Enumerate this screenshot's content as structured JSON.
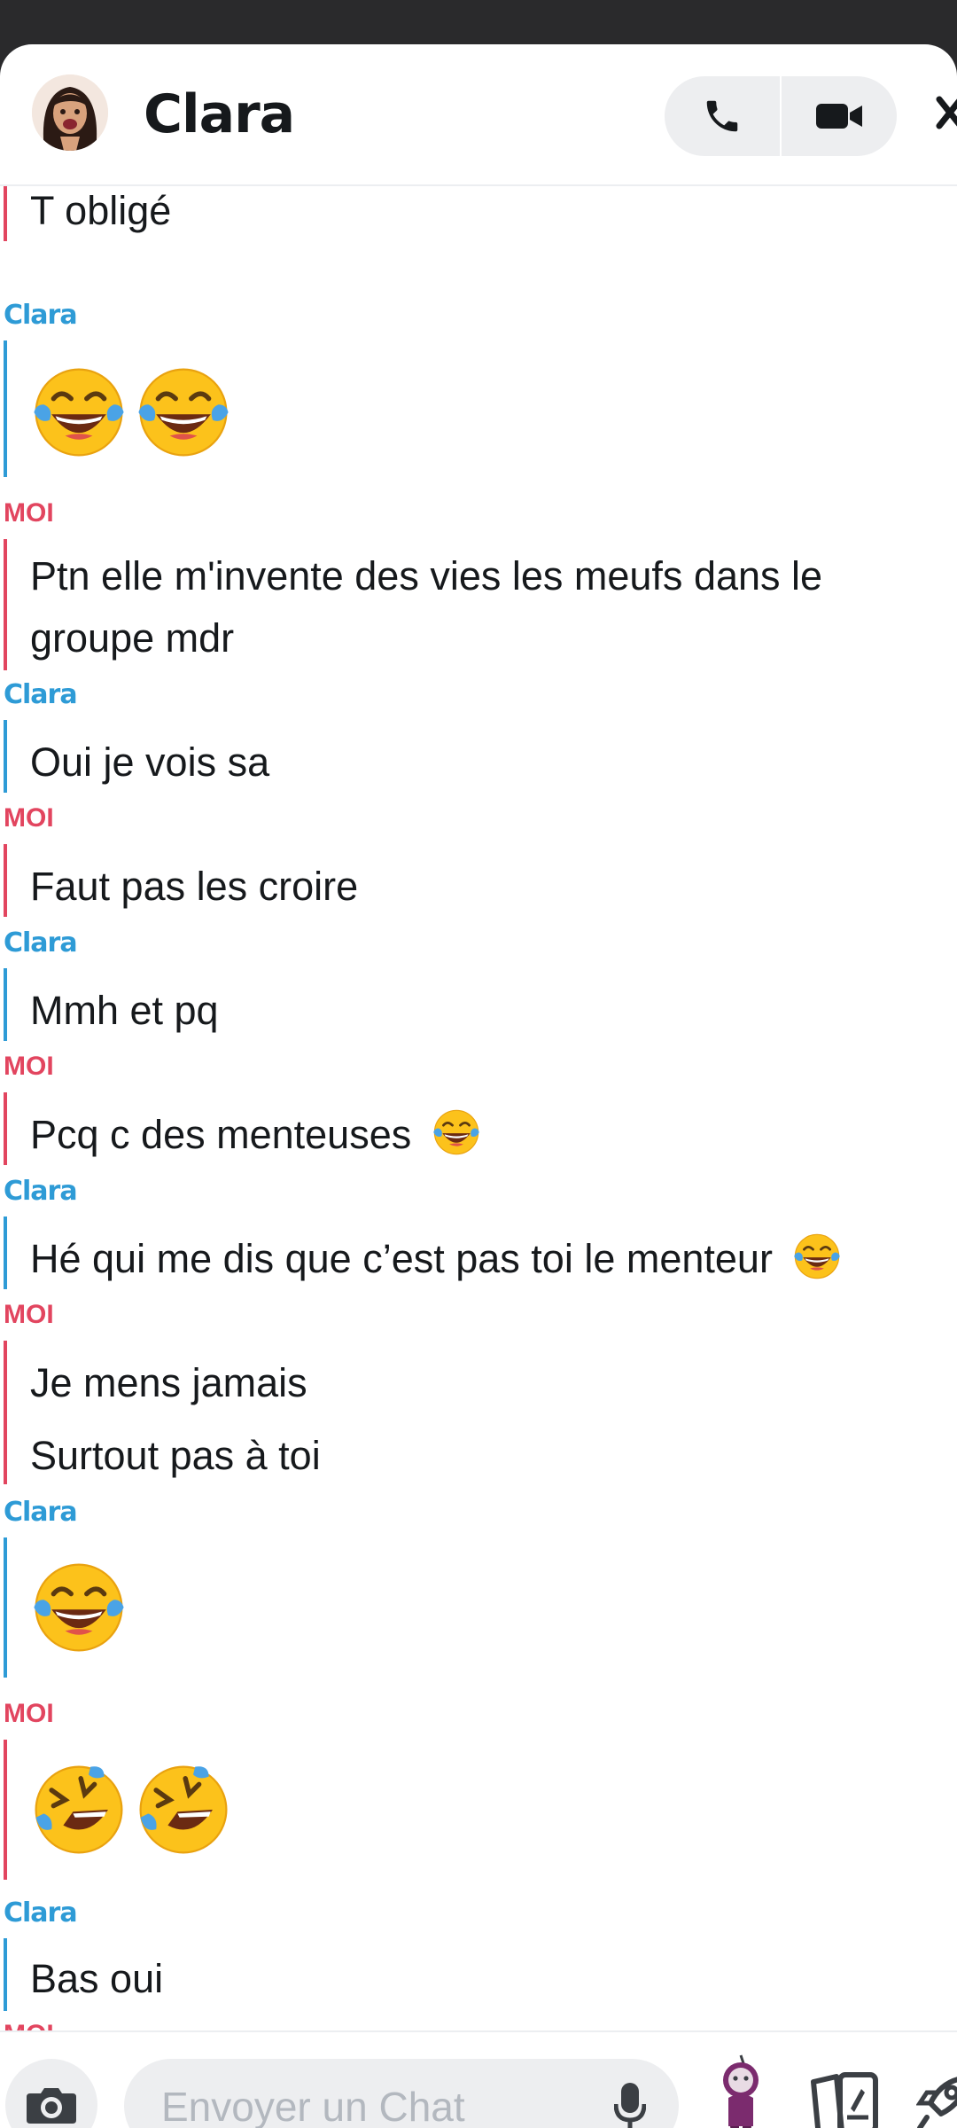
{
  "header": {
    "contact_name": "Clara",
    "avatar_icon": "bitmoji-avatar-icon",
    "call_icon": "phone-icon",
    "video_icon": "video-camera-icon",
    "close_icon": "close-icon"
  },
  "colors": {
    "friend_accent": "#2e9bd6",
    "me_accent": "#e2455f",
    "text": "#16191c",
    "input_bg": "#edeef0"
  },
  "chat": {
    "partial_top_message": "T obligé",
    "clara_label": "Clara",
    "me_label": "MOI",
    "messages": [
      {
        "sender": "Clara",
        "emoji": [
          "face-with-tears-of-joy",
          "face-with-tears-of-joy"
        ]
      },
      {
        "sender": "MOI",
        "line1": "Ptn elle m'invente des vies les meufs dans le",
        "line2": "groupe mdr"
      },
      {
        "sender": "Clara",
        "text": "Oui je vois sa"
      },
      {
        "sender": "MOI",
        "text": "Faut pas les croire"
      },
      {
        "sender": "Clara",
        "text": "Mmh et pq"
      },
      {
        "sender": "MOI",
        "text": "Pcq c des menteuses",
        "emoji": [
          "face-with-tears-of-joy"
        ]
      },
      {
        "sender": "Clara",
        "text": "Hé qui me dis que c’est pas toi le menteur",
        "emoji": [
          "face-with-tears-of-joy"
        ]
      },
      {
        "sender": "MOI",
        "line1": "Je mens jamais",
        "line2": "Surtout pas à toi"
      },
      {
        "sender": "Clara",
        "emoji": [
          "face-with-tears-of-joy"
        ]
      },
      {
        "sender": "MOI",
        "emoji": [
          "rolling-on-the-floor-laughing",
          "rolling-on-the-floor-laughing"
        ]
      },
      {
        "sender": "Clara",
        "text": "Bas oui"
      },
      {
        "sender": "MOI"
      }
    ]
  },
  "composer": {
    "placeholder": "Envoyer un Chat",
    "value": "",
    "camera_icon": "camera-icon",
    "mic_icon": "microphone-icon",
    "bitmoji_icon": "bitmoji-sticker-icon",
    "cards_icon": "cards-icon",
    "rocket_icon": "rocket-icon"
  }
}
